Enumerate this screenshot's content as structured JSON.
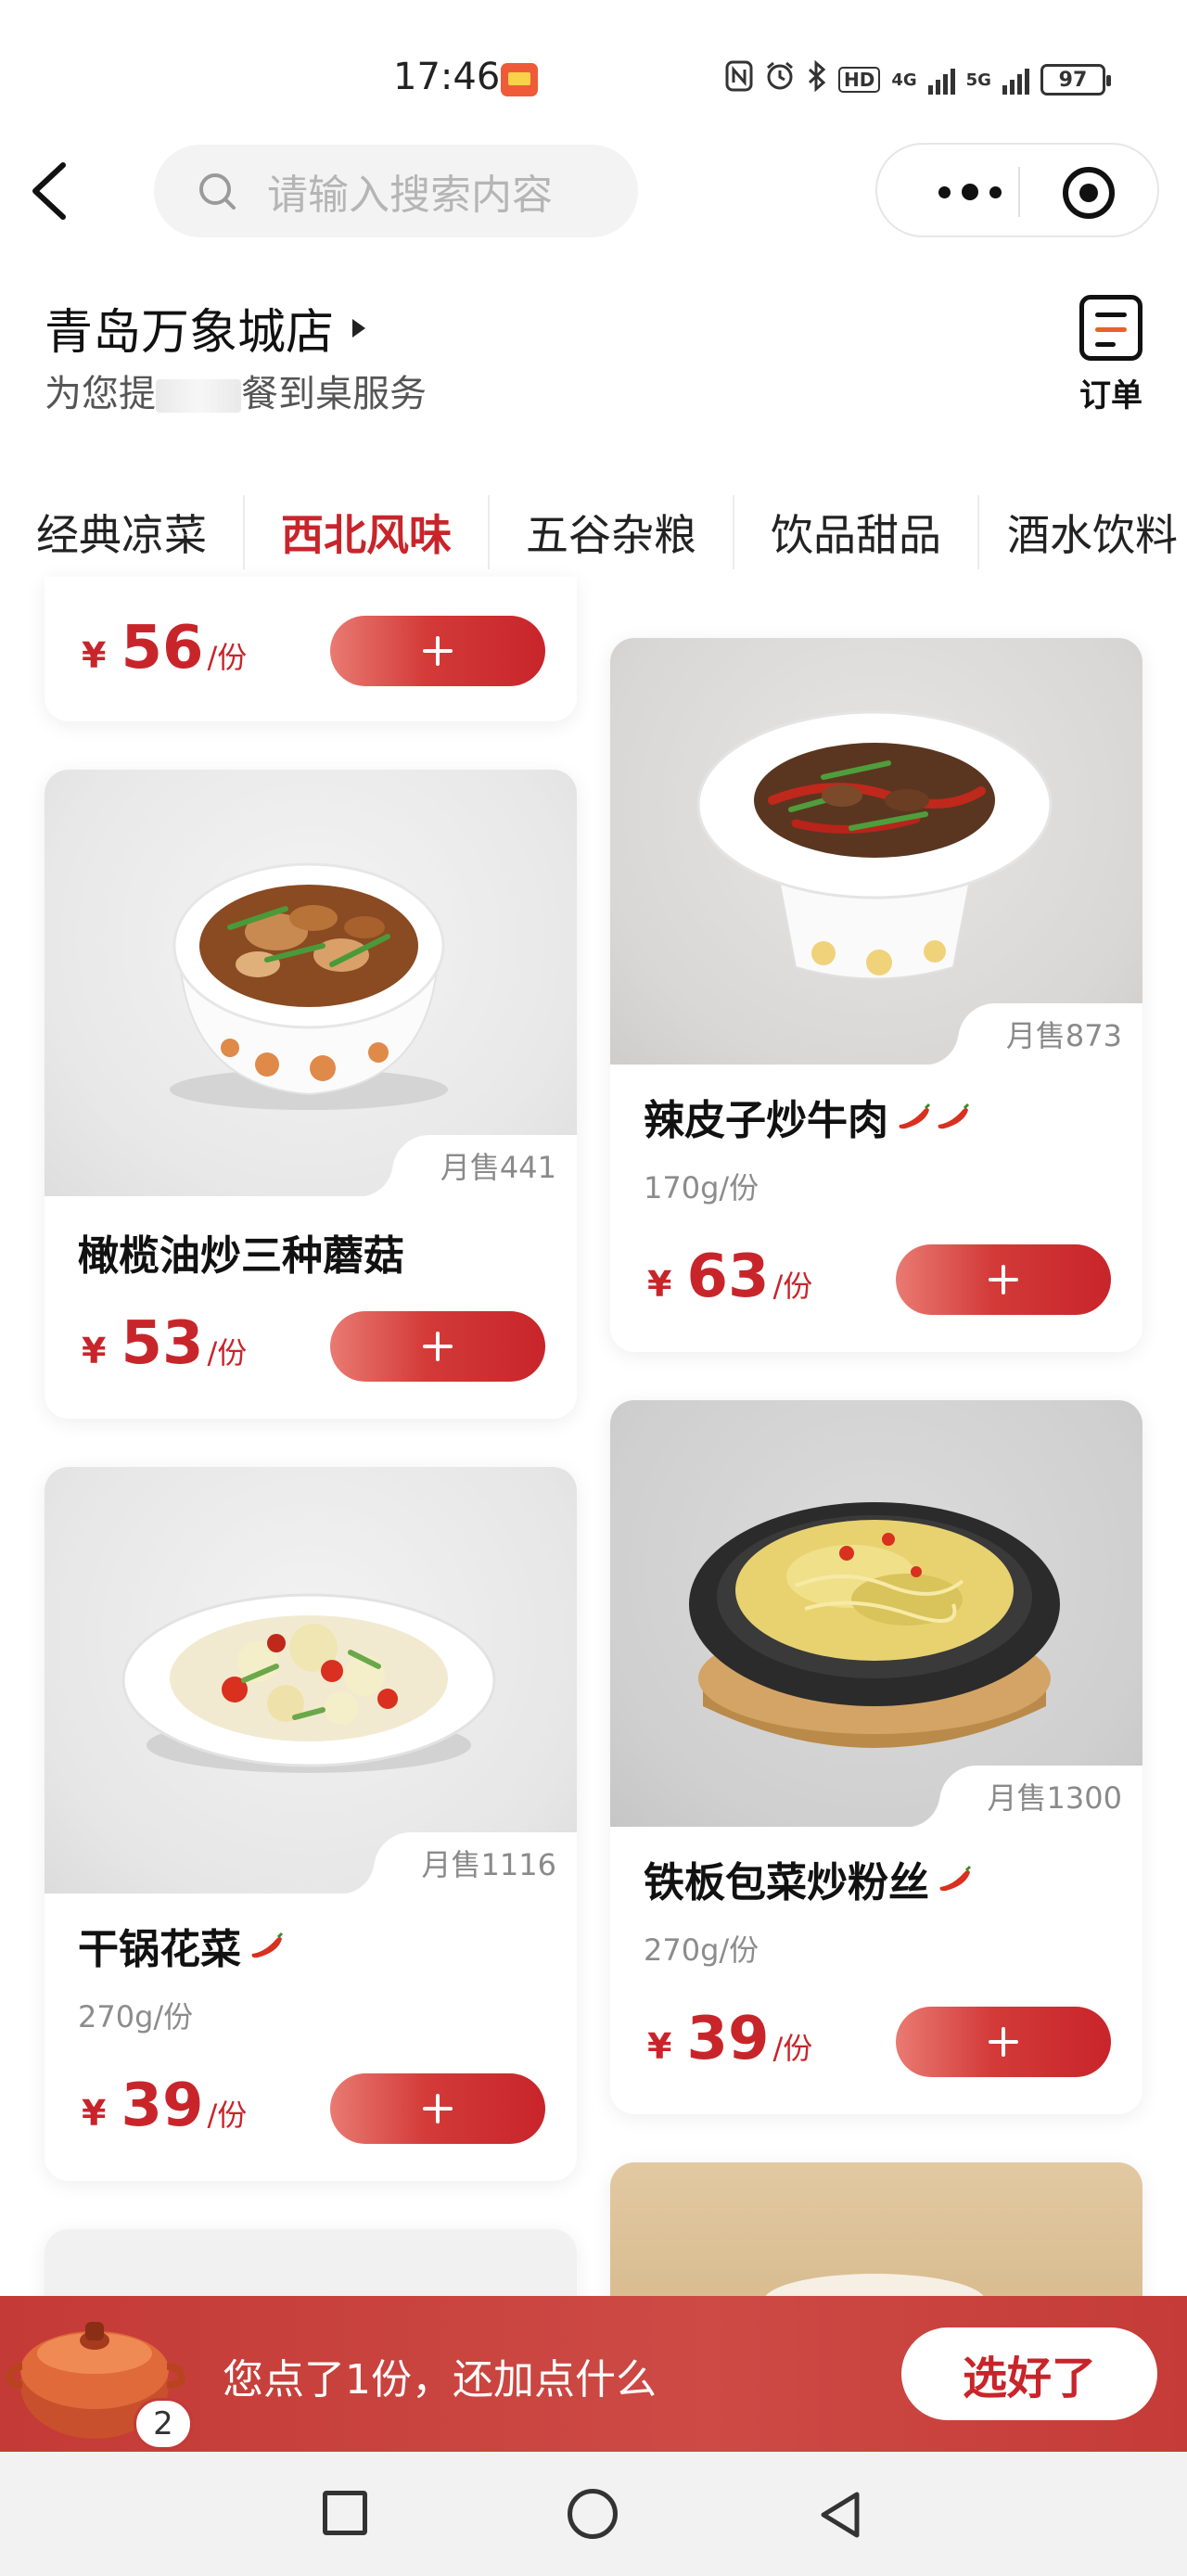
{
  "status_bar": {
    "time": "17:46",
    "network": "4G",
    "network2": "5G",
    "hd": "HD",
    "battery": "97"
  },
  "nav": {
    "search_placeholder": "请输入搜索内容"
  },
  "store": {
    "name": "青岛万象城店",
    "subtitle_left": "为您提",
    "subtitle_right": "餐到桌服务",
    "order_label": "订单"
  },
  "tabs": [
    "经典凉菜",
    "西北风味",
    "五谷杂粮",
    "饮品甜品",
    "酒水饮料"
  ],
  "active_tab": "西北风味",
  "currency": "¥",
  "unit": "/份",
  "partial_card": {
    "price": "56"
  },
  "dishes": [
    {
      "name": "橄榄油炒三种蘑菇",
      "monthly": "月售441",
      "spec": "",
      "price": "53",
      "spicy": 0
    },
    {
      "name": "辣皮子炒牛肉",
      "monthly": "月售873",
      "spec": "170g/份",
      "price": "63",
      "spicy": 2
    },
    {
      "name": "干锅花菜",
      "monthly": "月售1116",
      "spec": "270g/份",
      "price": "39",
      "spicy": 1
    },
    {
      "name": "铁板包菜炒粉丝",
      "monthly": "月售1300",
      "spec": "270g/份",
      "price": "39",
      "spicy": 1
    }
  ],
  "cart": {
    "message": "您点了1份，还加点什么",
    "count": "2",
    "done_label": "选好了"
  },
  "colors": {
    "accent": "#c8252b",
    "cart_bar": "#c94440"
  }
}
